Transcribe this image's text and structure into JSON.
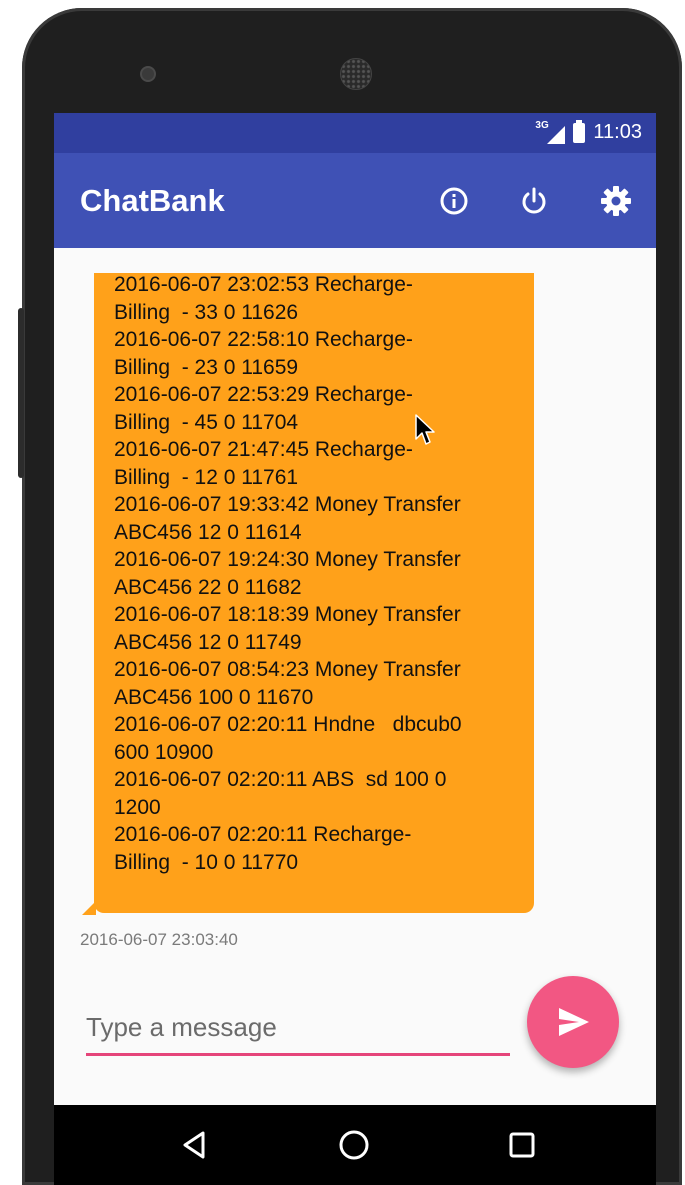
{
  "status_bar": {
    "network": "3G",
    "time": "11:03"
  },
  "app_bar": {
    "title": "ChatBank",
    "icons": [
      "info-icon",
      "power-icon",
      "gear-icon"
    ]
  },
  "message": {
    "lines": [
      "2016-06-07 23:02:53 Recharge-",
      "Billing  - 33 0 11626",
      "2016-06-07 22:58:10 Recharge-",
      "Billing  - 23 0 11659",
      "2016-06-07 22:53:29 Recharge-",
      "Billing  - 45 0 11704",
      "2016-06-07 21:47:45 Recharge-",
      "Billing  - 12 0 11761",
      "2016-06-07 19:33:42 Money Transfer",
      "ABC456 12 0 11614",
      "2016-06-07 19:24:30 Money Transfer",
      "ABC456 22 0 11682",
      "2016-06-07 18:18:39 Money Transfer",
      "ABC456 12 0 11749",
      "2016-06-07 08:54:23 Money Transfer",
      "ABC456 100 0 11670",
      "2016-06-07 02:20:11 Hndne   dbcub0",
      "600 10900",
      "2016-06-07 02:20:11 ABS  sd 100 0",
      "1200",
      "2016-06-07 02:20:11 Recharge-",
      "Billing  - 10 0 11770"
    ],
    "timestamp": "2016-06-07 23:03:40",
    "bubble_color": "#ffa11a"
  },
  "composer": {
    "placeholder": "Type a message",
    "value": "",
    "send_icon": "send-icon"
  },
  "nav_bar": {
    "icons": [
      "back-icon",
      "home-icon",
      "recent-apps-icon"
    ]
  },
  "colors": {
    "status_bar": "#303f9f",
    "app_bar": "#3f51b5",
    "accent": "#f25783",
    "bubble": "#ffa11a"
  }
}
